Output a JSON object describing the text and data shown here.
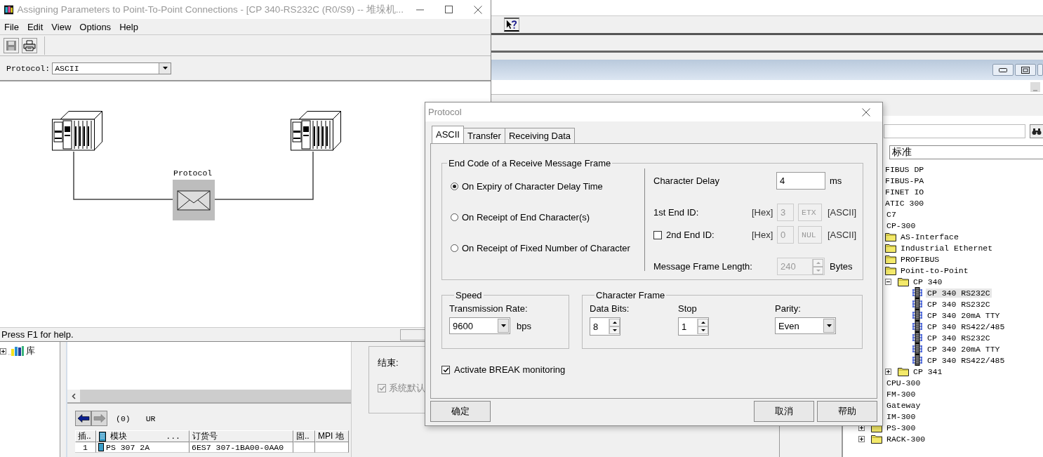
{
  "main_app": {
    "catalog": {
      "profile": "标准",
      "tree": [
        {
          "label": "FIBUS DP",
          "selected": false
        },
        {
          "label": "FIBUS-PA",
          "selected": false
        },
        {
          "label": "FINET IO",
          "selected": false
        },
        {
          "label": "ATIC 300",
          "selected": false,
          "children": [
            {
              "label": "C7",
              "selected": false
            },
            {
              "label": "CP-300",
              "selected": false,
              "children": [
                {
                  "label": "AS-Interface",
                  "kind": "folder",
                  "selected": false
                },
                {
                  "label": "Industrial Ethernet",
                  "kind": "folder",
                  "selected": false
                },
                {
                  "label": "PROFIBUS",
                  "kind": "folder",
                  "selected": false
                },
                {
                  "label": "Point-to-Point",
                  "kind": "folder",
                  "selected": false,
                  "children": [
                    {
                      "label": "CP 340",
                      "kind": "folder",
                      "expanded": true,
                      "selected": false,
                      "children": [
                        {
                          "label": "CP 340 RS232C",
                          "kind": "module",
                          "selected": true
                        },
                        {
                          "label": "CP 340 RS232C",
                          "kind": "module",
                          "selected": false
                        },
                        {
                          "label": "CP 340 20mA TTY",
                          "kind": "module",
                          "selected": false
                        },
                        {
                          "label": "CP 340 RS422/485",
                          "kind": "module",
                          "selected": false
                        },
                        {
                          "label": "CP 340 RS232C",
                          "kind": "module",
                          "selected": false
                        },
                        {
                          "label": "CP 340 20mA TTY",
                          "kind": "module",
                          "selected": false
                        },
                        {
                          "label": "CP 340 RS422/485",
                          "kind": "module",
                          "selected": false
                        }
                      ]
                    },
                    {
                      "label": "CP 341",
                      "kind": "folder",
                      "expanded": false,
                      "selected": false
                    }
                  ]
                }
              ]
            },
            {
              "label": "CPU-300",
              "selected": false
            },
            {
              "label": "FM-300",
              "selected": false
            },
            {
              "label": "Gateway",
              "selected": false
            },
            {
              "label": "IM-300",
              "selected": false
            },
            {
              "label": "PS-300",
              "kind": "folder",
              "expanded": false,
              "selected": false
            },
            {
              "label": "RACK-300",
              "kind": "folder",
              "expanded": false,
              "selected": false
            }
          ]
        }
      ]
    },
    "library": {
      "label": "库",
      "expanded": false
    },
    "rack": {
      "slot": "(0)",
      "name": "UR",
      "columns": [
        {
          "label": "插.."
        },
        {
          "label": "模块",
          "extra": "...",
          "icon": true
        },
        {
          "label": "订货号"
        },
        {
          "label": "固.."
        },
        {
          "label": "MPI 地"
        }
      ],
      "rows": [
        [
          "1",
          "PS 307 2A",
          "6ES7 307-1BA00-0AA0"
        ]
      ]
    },
    "side_panel": {
      "label": "结束:",
      "checkbox": {
        "label": "系统默认",
        "checked": true,
        "disabled": true
      }
    }
  },
  "param_window": {
    "title": "Assigning Parameters to Point-To-Point Connections - [CP 340-RS232C  (R0/S9)  -- 堆垛机...",
    "menu": [
      "File",
      "Edit",
      "View",
      "Options",
      "Help"
    ],
    "protocol_label": "Protocol:",
    "protocol_value": "ASCII",
    "diagram_label": "Protocol",
    "status": "Press F1 for help."
  },
  "dialog": {
    "title": "Protocol",
    "tabs": [
      {
        "label": "ASCII",
        "selected": true
      },
      {
        "label": "Transfer",
        "selected": false
      },
      {
        "label": "Receiving Data",
        "selected": false
      }
    ],
    "end_code": {
      "title": "End Code of a Receive Message Frame",
      "options": [
        {
          "label": "On Expiry of Character Delay Time",
          "selected": true
        },
        {
          "label": "On Receipt of End Character(s)",
          "selected": false
        },
        {
          "label": "On Receipt of Fixed Number of Character",
          "selected": false
        }
      ]
    },
    "char_delay": {
      "label": "Character Delay",
      "value": "4",
      "unit": "ms"
    },
    "end_ids": [
      {
        "kind": "plain",
        "label": "1st End ID:",
        "hex_label": "[Hex]",
        "hex": "3",
        "ascii": "ETX",
        "ascii_label": "[ASCII]",
        "disabled": true
      },
      {
        "kind": "checkbox",
        "checked": false,
        "label": "2nd End ID:",
        "hex_label": "[Hex]",
        "hex": "0",
        "ascii": "NUL",
        "ascii_label": "[ASCII]",
        "disabled": true
      }
    ],
    "frame_length": {
      "label": "Message Frame Length:",
      "value": "240",
      "unit": "Bytes",
      "disabled": true
    },
    "speed": {
      "title": "Speed",
      "label": "Transmission Rate:",
      "value": "9600",
      "unit": "bps"
    },
    "character_frame": {
      "title": "Character Frame",
      "fields": [
        {
          "kind": "spinner",
          "label": "Data Bits:",
          "value": "8"
        },
        {
          "kind": "spinner",
          "label": "Stop",
          "value": "1"
        },
        {
          "kind": "dropdown",
          "label": "Parity:",
          "value": "Even"
        }
      ]
    },
    "break_monitoring": {
      "label": "Activate BREAK monitoring",
      "checked": true
    },
    "buttons": [
      "确定",
      "取消",
      "帮助"
    ]
  }
}
